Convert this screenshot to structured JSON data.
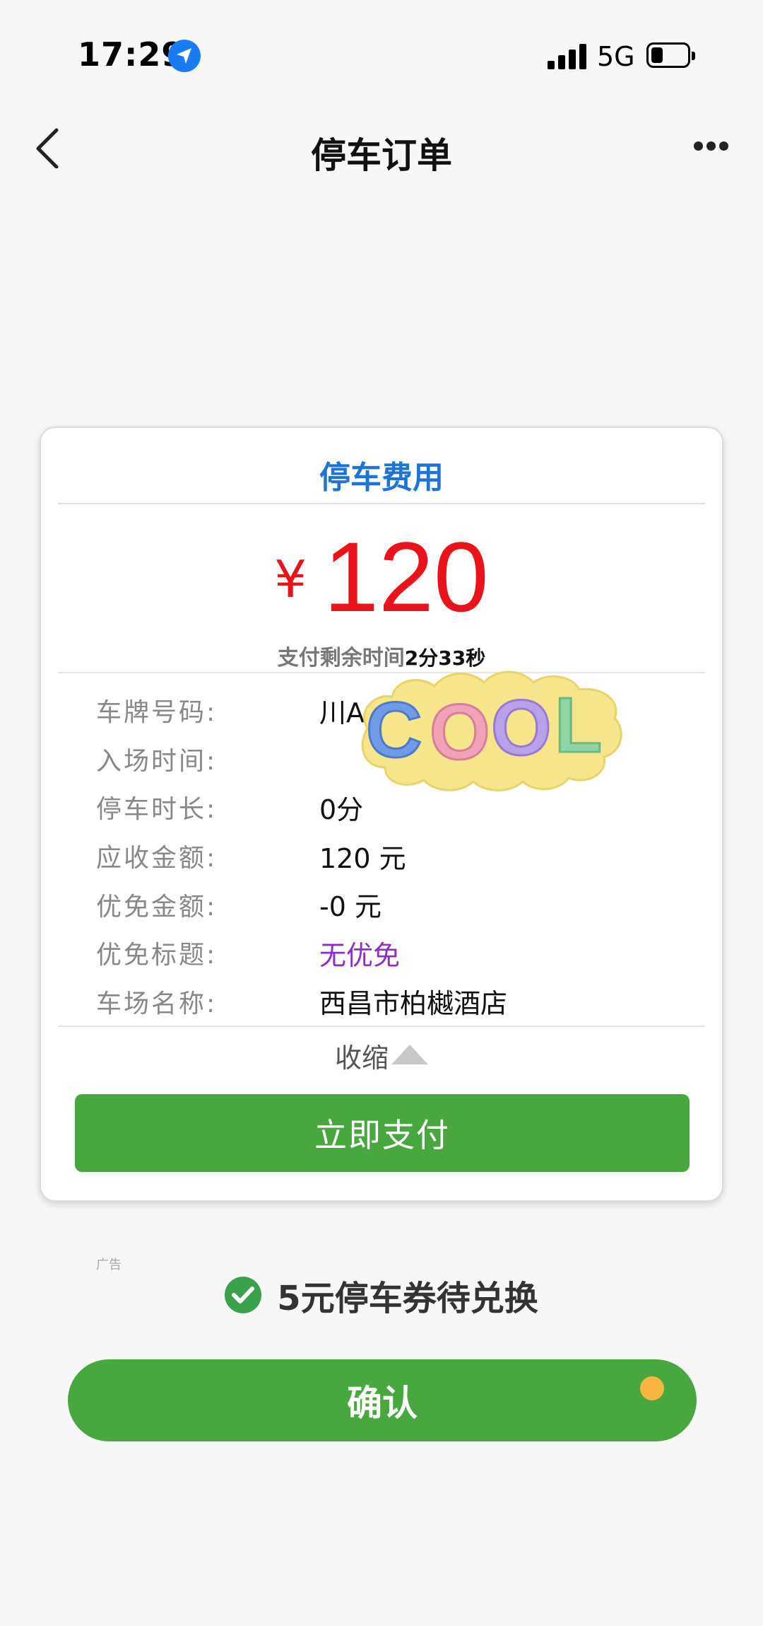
{
  "status_bar": {
    "time": "17:29",
    "network": "5G",
    "location_icon": "location-arrow-icon",
    "signal_icon": "signal-bars-icon",
    "battery_icon": "battery-icon"
  },
  "nav": {
    "title": "停车订单",
    "back_icon": "chevron-left-icon",
    "more_icon": "more-dots-icon"
  },
  "card": {
    "title": "停车费用",
    "currency": "¥",
    "amount": "120",
    "countdown_label": "支付剩余时间",
    "countdown_value": "2分33秒",
    "rows": [
      {
        "label": "车牌号码:",
        "value": "川A"
      },
      {
        "label": "入场时间:",
        "value": ""
      },
      {
        "label": "停车时长:",
        "value": "0分"
      },
      {
        "label": "应收金额:",
        "value": "120 元"
      },
      {
        "label": "优免金额:",
        "value": "-0 元"
      },
      {
        "label": "优免标题:",
        "value": "无优免"
      },
      {
        "label": "车场名称:",
        "value": "西昌市柏樾酒店"
      }
    ],
    "collapse_label": "收缩",
    "pay_button": "立即支付"
  },
  "sticker": {
    "text": "COOL",
    "colors": [
      "#6f9be8",
      "#f0a2b8",
      "#b9a0ea",
      "#8fd6a4"
    ],
    "background": "#f6e58a"
  },
  "ad": {
    "tag": "广告",
    "voucher_text": "5元停车券待兑换",
    "confirm_button": "确认"
  },
  "colors": {
    "accent_green": "#48a83f",
    "price_red": "#e8131b",
    "title_blue": "#1e73d8",
    "discount_purple": "#8e2ec4"
  }
}
